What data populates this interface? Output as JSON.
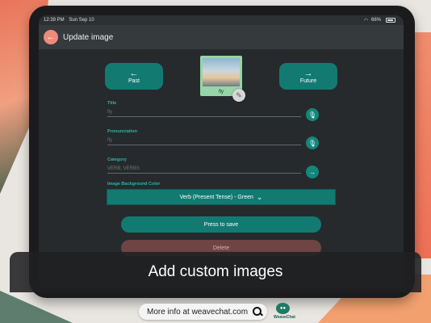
{
  "status_bar": {
    "time": "12:39 PM",
    "date": "Sun Sep 10",
    "battery": "66%"
  },
  "header": {
    "title": "Update image"
  },
  "nav": {
    "past_label": "Past",
    "future_label": "Future"
  },
  "image": {
    "label": "fly"
  },
  "fields": {
    "title": {
      "label": "Title",
      "placeholder": "fly"
    },
    "pronunciation": {
      "label": "Pronunciation",
      "placeholder": "fly"
    },
    "category": {
      "label": "Category",
      "placeholder": "VERB, VERBS"
    },
    "background_color": {
      "label": "Image Background Color",
      "value": "Verb (Present Tense) - Green"
    }
  },
  "actions": {
    "save_label": "Press to save",
    "delete_label": "Delete"
  },
  "caption": "Add custom images",
  "footer": {
    "info_text": "More info at weavechat.com",
    "logo_text": "WeaveChat"
  },
  "colors": {
    "accent": "#137a72",
    "label": "#2ab5a8",
    "back_button": "#f08a7b",
    "delete": "#6e4444"
  }
}
